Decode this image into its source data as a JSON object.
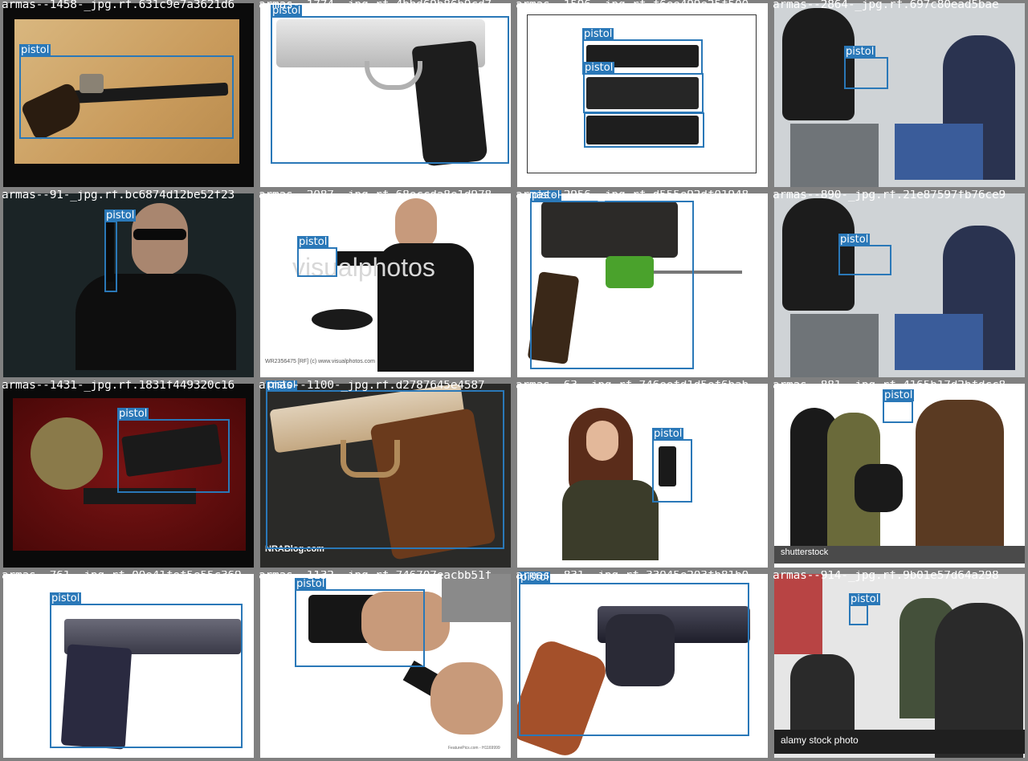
{
  "label": "pistol",
  "box_color": "#2a78b8",
  "tiles": [
    {
      "filename": "armas--1458-_jpg.rf.631c9e7a3621d6"
    },
    {
      "filename": "armas--1774-_jpg.rf.4bbd69b86b9cd7"
    },
    {
      "filename": "armas--1596-_jpg.rf.f6ee499e25f500"
    },
    {
      "filename": "armas--2864-_jpg.rf.697c80ead5bae"
    },
    {
      "filename": "armas--91-_jpg.rf.bc6874d12be52f23"
    },
    {
      "filename": "armas--2087-_jpg.rf.68eccda8e1d978"
    },
    {
      "filename": "armas--2956-_jpg.rf.d555e92df01948"
    },
    {
      "filename": "armas--890-_jpg.rf.21e87597fb76ce9"
    },
    {
      "filename": "armas--1431-_jpg.rf.1831f449320c16"
    },
    {
      "filename": "armas--1100-_jpg.rf.d2787645e4587"
    },
    {
      "filename": "armas--63-_jpg.rf.746eefd1d5ef6bab"
    },
    {
      "filename": "armas--881-_jpg.rf.4165b17d2bfdcc8"
    },
    {
      "filename": "armas--761-_jpg.rf.00e41fef5e55c369"
    },
    {
      "filename": "armas--1132-_jpg.rf.746707eacbb51f"
    },
    {
      "filename": "armas--831-_jpg.rf.33045e203fb81b0"
    },
    {
      "filename": "armas--914-_jpg.rf.9b01e57d64a298"
    }
  ],
  "watermarks": {
    "visualphotos": "visualphotos",
    "visualphotos_caption": "WR2356475 [RF] (c) www.visualphotos.com",
    "nrablog": "NRABlog.com",
    "shutterstock": "shutterstock",
    "alamy": "alamy stock photo",
    "featurepics": "FeaturePics.com - H1169999"
  }
}
